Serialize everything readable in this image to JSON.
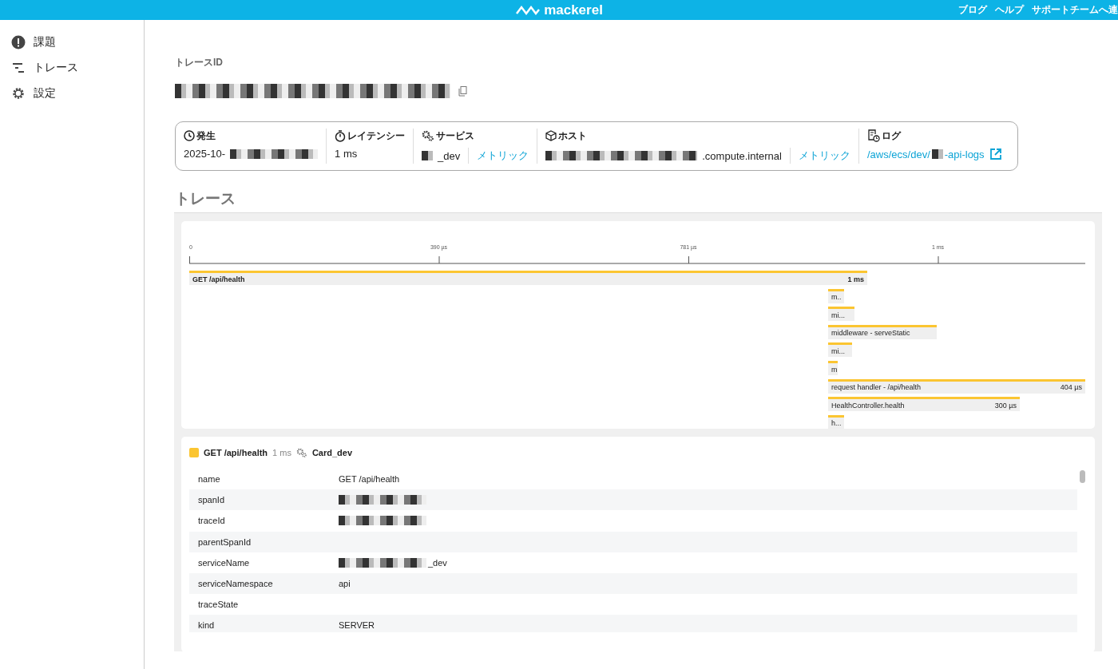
{
  "header": {
    "logo": "mackerel",
    "links": [
      "ブログ",
      "ヘルプ",
      "サポートチームへ連"
    ]
  },
  "sidebar": {
    "items": [
      {
        "label": "課題"
      },
      {
        "label": "トレース"
      },
      {
        "label": "設定"
      }
    ]
  },
  "trace_id": {
    "label": "トレースID"
  },
  "summary": [
    {
      "kind": "plain",
      "label": "発生",
      "value": "2025-10-",
      "redacted": true
    },
    {
      "kind": "plain",
      "label": "レイテンシー",
      "value": "1 ms",
      "redacted": false
    },
    {
      "kind": "link",
      "label": "サービス",
      "value": "_dev",
      "redacted": true,
      "link": "メトリック"
    },
    {
      "kind": "link",
      "label": "ホスト",
      "value": ".compute.internal",
      "redacted": true,
      "link": "メトリック"
    },
    {
      "kind": "external",
      "label": "ログ",
      "value_prefix": "/aws/ecs/dev/",
      "value": "-api-logs",
      "redacted": true
    }
  ],
  "section_title": "トレース",
  "waterfall": {
    "ticks": [
      "0",
      "390 µs",
      "781 µs",
      "1 ms"
    ],
    "root": {
      "name": "GET /api/health",
      "duration": "1 ms",
      "children": [
        {
          "name": "m.."
        },
        {
          "name": "mi..."
        },
        {
          "name": "middleware - serveStatic"
        },
        {
          "name": "mi..."
        },
        {
          "name": "m"
        },
        {
          "name": "request handler - /api/health",
          "duration": "404 µs"
        },
        {
          "name": "HealthController.health",
          "duration": "300 µs"
        },
        {
          "name": "h..."
        }
      ]
    }
  },
  "span_detail": {
    "name": "GET /api/health",
    "duration": "1 ms",
    "service": "Card_dev",
    "color": "#fbc531",
    "rows": [
      {
        "key": "name",
        "value": "GET /api/health",
        "redacted": false
      },
      {
        "key": "spanId",
        "redacted": true
      },
      {
        "key": "traceId",
        "redacted": true
      },
      {
        "key": "parentSpanId",
        "redacted": false
      },
      {
        "key": "serviceName",
        "value": "_dev",
        "redacted": true
      },
      {
        "key": "serviceNamespace",
        "value": "api",
        "redacted": false
      },
      {
        "key": "traceState",
        "redacted": false
      },
      {
        "key": "kind",
        "value": "SERVER",
        "redacted": false
      }
    ]
  }
}
